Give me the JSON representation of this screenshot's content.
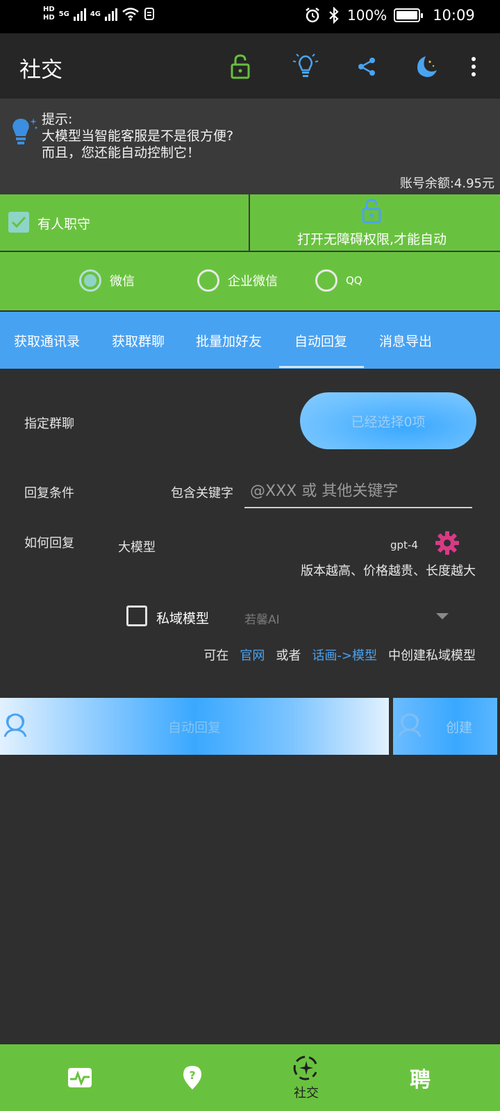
{
  "status_bar": {
    "hd1": "HD",
    "hd2": "HD",
    "net1": "5G",
    "net2": "4G",
    "battery": "100%",
    "time": "10:09",
    "icons": [
      "alarm-icon",
      "bluetooth-icon",
      "battery-icon",
      "wifi-icon",
      "nfc-icon"
    ]
  },
  "app_bar": {
    "title": "社交",
    "icons": [
      "lock-icon",
      "lightbulb-icon",
      "share-icon",
      "night-mode-icon",
      "more-vert-icon"
    ],
    "colors": {
      "lock": "#66c03d",
      "accent": "#4aa3f0",
      "background": "#262626"
    }
  },
  "tip": {
    "heading": "提示:",
    "line1": "大模型当智能客服是不是很方便?",
    "line2": "而且，您还能自动控制它！",
    "balance": "账号余额:4.95元"
  },
  "guard": {
    "checkbox_label": "有人职守",
    "checked": true,
    "accessibility_label": "打开无障碍权限,才能自动"
  },
  "platforms": {
    "options": [
      "微信",
      "企业微信",
      "QQ"
    ],
    "selected": "微信"
  },
  "tabs": {
    "items": [
      "获取通讯录",
      "获取群聊",
      "批量加好友",
      "自动回复",
      "消息导出"
    ],
    "active": "自动回复"
  },
  "form": {
    "group_label": "指定群聊",
    "group_button": "已经选择0项",
    "condition_label": "回复条件",
    "keyword_label": "包含关键字",
    "keyword_placeholder": "@XXX 或 其他关键字",
    "how_label": "如何回复",
    "model_label": "大模型",
    "model_version": "gpt-4",
    "model_hint": "版本越高、价格越贵、长度越大",
    "private_model_label": "私域模型",
    "private_model_checked": false,
    "private_model_value": "若馨AI",
    "create_hint_prefix": "可在",
    "create_hint_link1": "官网",
    "create_hint_or": "或者",
    "create_hint_link2": "话画->模型",
    "create_hint_suffix": "中创建私域模型"
  },
  "actions": {
    "auto_reply": "自动回复",
    "create": "创建"
  },
  "bottom_nav": {
    "items": [
      "activity-icon",
      "location-help-icon",
      "social-icon",
      "recruit-icon"
    ],
    "active_label": "社交",
    "recruit_char": "聘"
  }
}
